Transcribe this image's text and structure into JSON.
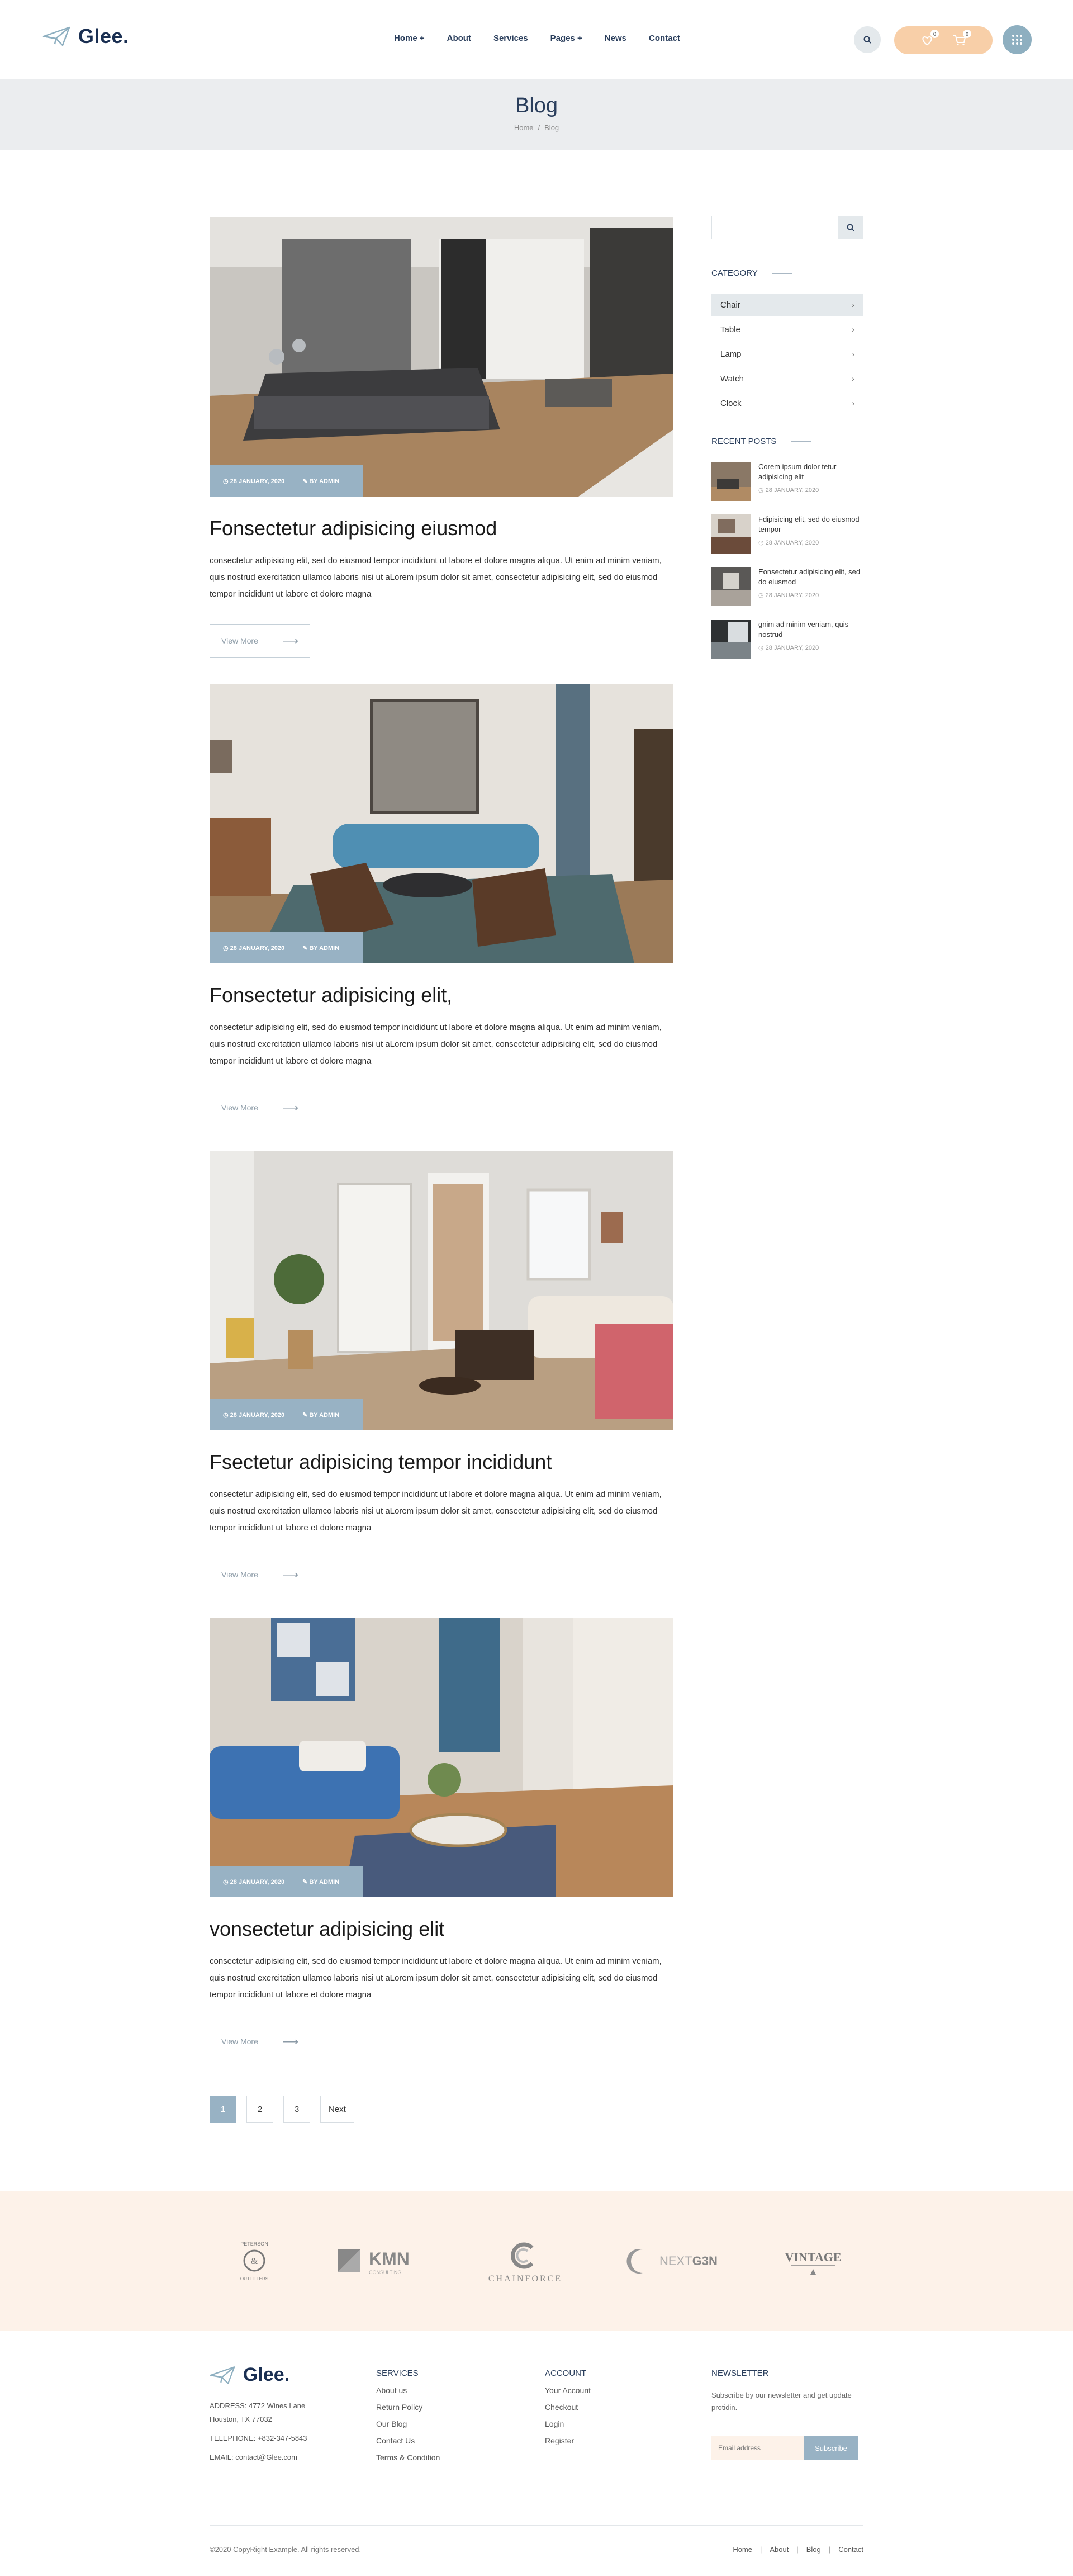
{
  "header": {
    "logo": "Glee.",
    "nav": [
      "Home +",
      "About",
      "Services",
      "Pages +",
      "News",
      "Contact"
    ],
    "cart_badge_1": "0",
    "cart_badge_2": "0"
  },
  "banner": {
    "title": "Blog",
    "breadcrumb_home": "Home",
    "breadcrumb_sep": "/",
    "breadcrumb_current": "Blog"
  },
  "posts": [
    {
      "date": "28 JANUARY, 2020",
      "author": "BY ADMIN",
      "title": "Fonsectetur adipisicing  eiusmod",
      "text": "consectetur adipisicing elit, sed do eiusmod tempor incididunt ut labore et dolore magna aliqua. Ut enim ad minim veniam, quis nostrud exercitation ullamco laboris nisi ut aLorem ipsum dolor sit amet, consectetur adipisicing elit, sed do eiusmod tempor incididunt ut labore et dolore magna",
      "button": "View More"
    },
    {
      "date": "28 JANUARY, 2020",
      "author": "BY ADMIN",
      "title": "Fonsectetur adipisicing elit,",
      "text": "consectetur adipisicing elit, sed do eiusmod tempor incididunt ut labore et dolore magna aliqua. Ut enim ad minim veniam, quis nostrud exercitation ullamco laboris nisi ut aLorem ipsum dolor sit amet, consectetur adipisicing elit, sed do eiusmod tempor incididunt ut labore et dolore magna",
      "button": "View More"
    },
    {
      "date": "28 JANUARY, 2020",
      "author": "BY ADMIN",
      "title": "Fsectetur adipisicing tempor incididunt",
      "text": "consectetur adipisicing elit, sed do eiusmod tempor incididunt ut labore et dolore magna aliqua. Ut enim ad minim veniam, quis nostrud exercitation ullamco laboris nisi ut aLorem ipsum dolor sit amet, consectetur adipisicing elit, sed do eiusmod tempor incididunt ut labore et dolore magna",
      "button": "View More"
    },
    {
      "date": "28 JANUARY, 2020",
      "author": "BY ADMIN",
      "title": "vonsectetur adipisicing elit",
      "text": "consectetur adipisicing elit, sed do eiusmod tempor incididunt ut labore et dolore magna aliqua. Ut enim ad minim veniam, quis nostrud exercitation ullamco laboris nisi ut aLorem ipsum dolor sit amet, consectetur adipisicing elit, sed do eiusmod tempor incididunt ut labore et dolore magna",
      "button": "View More"
    }
  ],
  "pagination": [
    "1",
    "2",
    "3",
    "Next"
  ],
  "sidebar": {
    "search_placeholder": "",
    "category_heading": "CATEGORY",
    "categories": [
      "Chair",
      "Table",
      "Lamp",
      "Watch",
      "Clock"
    ],
    "recent_heading": "RECENT POSTS",
    "recent_posts": [
      {
        "title": "Corem ipsum dolor tetur adipisicing elit",
        "date": "28 JANUARY, 2020"
      },
      {
        "title": "Fdipisicing elit, sed do eiusmod tempor",
        "date": "28 JANUARY, 2020"
      },
      {
        "title": "Eonsectetur adipisicing elit, sed do eiusmod",
        "date": "28 JANUARY, 2020"
      },
      {
        "title": "gnim ad minim veniam, quis nostrud",
        "date": "28 JANUARY, 2020"
      }
    ]
  },
  "brands": {
    "brand1_top": "PETERSON",
    "brand1_bottom": "OUTFITTERS",
    "brand2": "KMN",
    "brand2_sub": "CONSULTING",
    "brand3": "CHAINFORCE",
    "brand4_a": "NEXT",
    "brand4_b": "G3N",
    "brand5": "VINTAGE"
  },
  "footer": {
    "logo": "Glee.",
    "address": "ADDRESS: 4772 Wines Lane",
    "city": "Houston, TX 77032",
    "telephone": "TELEPHONE: +832-347-5843",
    "email": "EMAIL: contact@Glee.com",
    "services_heading": "SERVICES",
    "services": [
      "About us",
      "Return Policy",
      "Our Blog",
      "Contact Us",
      "Terms & Condition"
    ],
    "account_heading": "ACCOUNT",
    "account": [
      "Your Account",
      "Checkout",
      "Login",
      "Register"
    ],
    "newsletter_heading": "NEWSLETTER",
    "newsletter_text": "Subscribe by our newsletter and get update protidin.",
    "email_placeholder": "Email address",
    "subscribe": "Subscribe",
    "copyright": "©2020 CopyRight Example. All rights reserved.",
    "bottom_links": [
      "Home",
      "About",
      "Blog",
      "Contact"
    ]
  },
  "colors": {
    "accent": "#98b2c4",
    "peach": "#f8cfa8",
    "navy": "#1a2f52"
  }
}
